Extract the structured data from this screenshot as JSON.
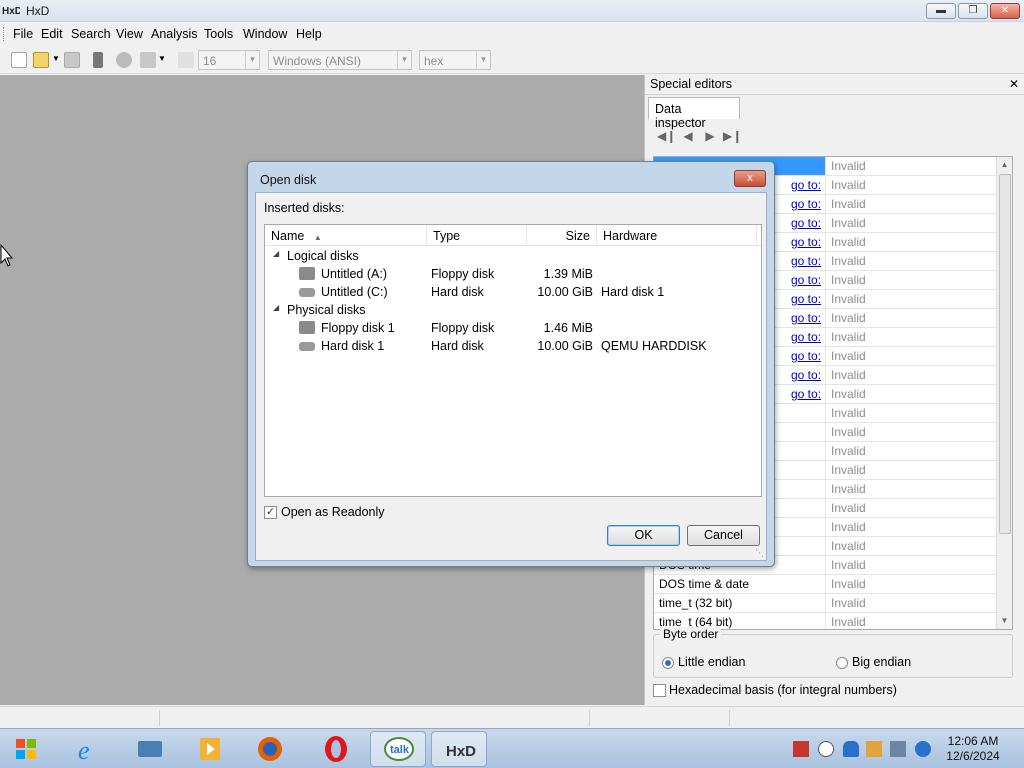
{
  "window": {
    "title": "HxD"
  },
  "menu": [
    "File",
    "Edit",
    "Search",
    "View",
    "Analysis",
    "Tools",
    "Window",
    "Help"
  ],
  "toolbar": {
    "bytes_per_row": "16",
    "charset": "Windows (ANSI)",
    "offset_base": "hex"
  },
  "special_editors": {
    "header": "Special editors",
    "tab": "Data inspector",
    "rows": [
      {
        "name": "",
        "link": "",
        "value": "Invalid",
        "selected": true
      },
      {
        "name": "",
        "link": "go to:",
        "value": "Invalid"
      },
      {
        "name": "",
        "link": "go to:",
        "value": "Invalid"
      },
      {
        "name": "",
        "link": "go to:",
        "value": "Invalid"
      },
      {
        "name": "",
        "link": "go to:",
        "value": "Invalid"
      },
      {
        "name": "",
        "link": "go to:",
        "value": "Invalid"
      },
      {
        "name": "",
        "link": "go to:",
        "value": "Invalid"
      },
      {
        "name": "",
        "link": "go to:",
        "value": "Invalid"
      },
      {
        "name": "",
        "link": "go to:",
        "value": "Invalid"
      },
      {
        "name": "",
        "link": "go to:",
        "value": "Invalid"
      },
      {
        "name": "",
        "link": "go to:",
        "value": "Invalid"
      },
      {
        "name": "",
        "link": "go to:",
        "value": "Invalid"
      },
      {
        "name": "",
        "link": "go to:",
        "value": "Invalid"
      },
      {
        "name": "",
        "link": "",
        "value": "Invalid"
      },
      {
        "name": "",
        "link": "",
        "value": "Invalid"
      },
      {
        "name": "",
        "link": "",
        "value": "Invalid"
      },
      {
        "name": "",
        "link": "",
        "value": "Invalid"
      },
      {
        "name": "",
        "link": "",
        "value": "Invalid"
      },
      {
        "name": "",
        "link": "",
        "value": "Invalid"
      },
      {
        "name": "",
        "link": "",
        "value": "Invalid"
      },
      {
        "name": "",
        "link": "",
        "value": "Invalid"
      },
      {
        "name": "DOS time",
        "link": "",
        "value": "Invalid"
      },
      {
        "name": "DOS time & date",
        "link": "",
        "value": "Invalid"
      },
      {
        "name": "time_t (32 bit)",
        "link": "",
        "value": "Invalid"
      },
      {
        "name": "time_t (64 bit)",
        "link": "",
        "value": "Invalid"
      }
    ],
    "byte_order": {
      "legend": "Byte order",
      "little": "Little endian",
      "big": "Big endian",
      "selected": "little"
    },
    "hex_basis": {
      "label": "Hexadecimal basis (for integral numbers)",
      "checked": false
    }
  },
  "dialog": {
    "title": "Open disk",
    "close_glyph": "x",
    "inserted_label": "Inserted disks:",
    "columns": [
      "Name",
      "Type",
      "Size",
      "Hardware"
    ],
    "groups": [
      {
        "name": "Logical disks",
        "items": [
          {
            "name": "Untitled (A:)",
            "type": "Floppy disk",
            "size": "1.39 MiB",
            "hardware": "",
            "icon": "floppy-drive-icon"
          },
          {
            "name": "Untitled (C:)",
            "type": "Hard disk",
            "size": "10.00 GiB",
            "hardware": "Hard disk 1",
            "icon": "hard-drive-icon"
          }
        ]
      },
      {
        "name": "Physical disks",
        "items": [
          {
            "name": "Floppy disk 1",
            "type": "Floppy disk",
            "size": "1.46 MiB",
            "hardware": "",
            "icon": "floppy-drive-icon"
          },
          {
            "name": "Hard disk 1",
            "type": "Hard disk",
            "size": "10.00 GiB",
            "hardware": "QEMU HARDDISK",
            "icon": "hard-drive-icon"
          }
        ]
      }
    ],
    "readonly": {
      "label": "Open as Readonly",
      "checked": true
    },
    "ok_label": "OK",
    "cancel_label": "Cancel"
  },
  "taskbar": {
    "apps": [
      "internet-explorer-icon",
      "folder-icon",
      "media-player-icon",
      "firefox-icon",
      "opera-icon",
      "google-talk-icon",
      "hxd-icon"
    ],
    "clock": {
      "time": "12:06 AM",
      "date": "12/6/2024"
    }
  },
  "colors": {
    "selection": "#3399ff",
    "link": "#0000cc",
    "mdi_background": "#ababab",
    "dialog_frame": "#c4d6ea"
  }
}
